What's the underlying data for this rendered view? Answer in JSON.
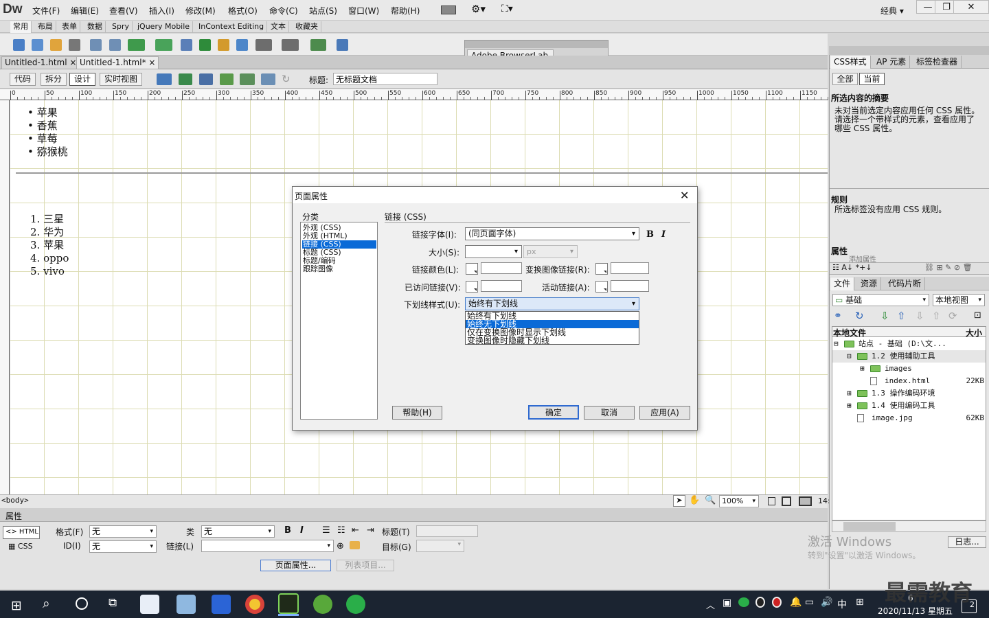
{
  "app": {
    "logo": "Dw",
    "menus": [
      "文件(F)",
      "编辑(E)",
      "查看(V)",
      "插入(I)",
      "修改(M)",
      "格式(O)",
      "命令(C)",
      "站点(S)",
      "窗口(W)",
      "帮助(H)"
    ],
    "workspace": "经典",
    "workspace_arrow": "▾",
    "window_minimize": "—",
    "window_maximize": "❐",
    "window_close": "✕"
  },
  "insert_tabs": [
    "常用",
    "布局",
    "表单",
    "数据",
    "Spry",
    "jQuery Mobile",
    "InContext Editing",
    "文本",
    "收藏夹"
  ],
  "document_tabs": [
    {
      "label": "Untitled-1.html",
      "close": "×"
    },
    {
      "label": "Untitled-1.html*",
      "close": "×"
    }
  ],
  "view_buttons": [
    "代码",
    "拆分",
    "设计",
    "实时视图"
  ],
  "doc_title": {
    "label": "标题:",
    "value": "无标题文档"
  },
  "ruler": {
    "ticks": [
      "0",
      "50",
      "100",
      "150",
      "200",
      "250",
      "300",
      "350",
      "400",
      "450",
      "500",
      "550",
      "600",
      "650",
      "700",
      "750",
      "800",
      "850",
      "900",
      "950",
      "1000",
      "1050",
      "1100",
      "1150"
    ]
  },
  "content": {
    "unordered_list": [
      "苹果",
      "香蕉",
      "草莓",
      "猕猴桃"
    ],
    "ordered_list": [
      {
        "num": "1.",
        "text": "三星"
      },
      {
        "num": "2.",
        "text": "华为"
      },
      {
        "num": "3.",
        "text": "苹果"
      },
      {
        "num": "4.",
        "text": "oppo"
      },
      {
        "num": "5.",
        "text": "vivo"
      }
    ]
  },
  "status": {
    "tag": "<body>",
    "zoom": "100%",
    "zoom_arrow": "▾",
    "size": "14:"
  },
  "properties": {
    "header": "属性",
    "html_btn": "<> HTML",
    "css_btn": "CSS",
    "format_label": "格式(F)",
    "format_value": "无",
    "class_label": "类",
    "class_value": "无",
    "id_label": "ID(I)",
    "id_value": "无",
    "link_label": "链接(L)",
    "title_label": "标题(T)",
    "target_label": "目标(G)",
    "bold": "B",
    "italic": "I",
    "page_props_btn": "页面属性...",
    "list_item_btn": "列表项目..."
  },
  "browserlab": {
    "title": "Adobe BrowserLab"
  },
  "right_panel": {
    "tabs": [
      "CSS样式",
      "AP 元素",
      "标签检查器"
    ],
    "mode_tabs": [
      "全部",
      "当前"
    ],
    "summary_title": "所选内容的摘要",
    "summary_text": "未对当前选定内容应用任何 CSS 属性。请选择一个带样式的元素，查看应用了哪些 CSS 属性。",
    "rules_title": "规则",
    "rules_text": "所选标签没有应用 CSS 规则。",
    "attrs_title": "属性",
    "attrs_text": "添加属性",
    "files_tabs": [
      "文件",
      "资源",
      "代码片断"
    ],
    "site_select": "基础",
    "view_select": "本地视图",
    "col_local": "本地文件",
    "col_size": "大小",
    "tree": [
      {
        "toggle": "⊟",
        "name": "站点 - 基础 (D:\\文...",
        "size": "",
        "indent": 0
      },
      {
        "toggle": "⊟",
        "name": "1.2 使用辅助工具",
        "size": "",
        "indent": 1
      },
      {
        "toggle": "⊞",
        "name": "images",
        "size": "",
        "indent": 2
      },
      {
        "toggle": "",
        "name": "index.html",
        "size": "22KB",
        "indent": 2
      },
      {
        "toggle": "⊞",
        "name": "1.3 操作编码环境",
        "size": "",
        "indent": 1
      },
      {
        "toggle": "⊞",
        "name": "1.4 使用编码工具",
        "size": "",
        "indent": 1
      },
      {
        "toggle": "",
        "name": "image.jpg",
        "size": "62KB",
        "indent": 1
      }
    ],
    "log_btn": "日志..."
  },
  "watermark": {
    "line1": "激活 Windows",
    "line2": "转到\"设置\"以激活 Windows。"
  },
  "brand": "最需教育",
  "taskbar": {
    "time_partial": "6",
    "date": "2020/11/13 星期五",
    "ime": "中",
    "notification_count": "2"
  },
  "dialog": {
    "title": "页面属性",
    "close": "✕",
    "category_label": "分类",
    "categories": [
      "外观 (CSS)",
      "外观 (HTML)",
      "链接 (CSS)",
      "标题 (CSS)",
      "标题/编码",
      "跟踪图像"
    ],
    "selected_category": 2,
    "section_title": "链接 (CSS)",
    "link_font_label": "链接字体(I):",
    "link_font_value": "(同页面字体)",
    "bold": "B",
    "italic": "I",
    "size_label": "大小(S):",
    "size_unit": "px",
    "link_color_label": "链接颜色(L):",
    "rollover_label": "变换图像链接(R):",
    "visited_label": "已访问链接(V):",
    "active_label": "活动链接(A):",
    "underline_label": "下划线样式(U):",
    "underline_value": "始终有下划线",
    "underline_options": [
      "始终有下划线",
      "始终无下划线",
      "仅在变换图像时显示下划线",
      "变换图像时隐藏下划线"
    ],
    "highlighted_option": 1,
    "help_btn": "帮助(H)",
    "ok_btn": "确定",
    "cancel_btn": "取消",
    "apply_btn": "应用(A)"
  }
}
